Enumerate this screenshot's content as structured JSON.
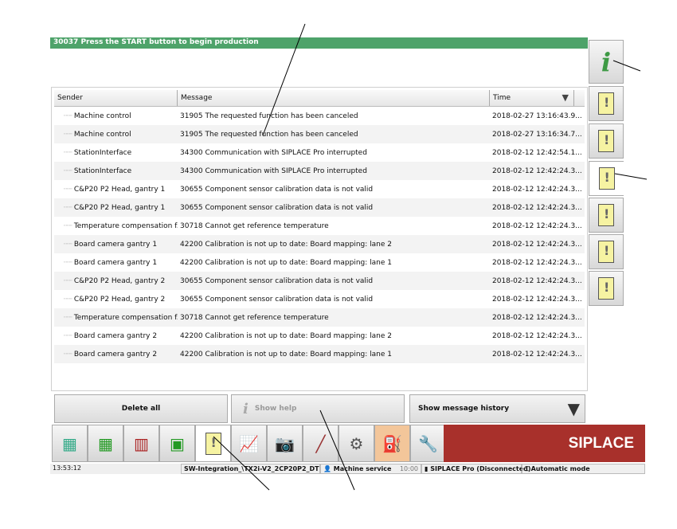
{
  "status_message": "30037 Press the START button to begin production",
  "table": {
    "columns": [
      "Sender",
      "Message",
      "Time"
    ],
    "rows": [
      [
        "Machine control",
        "31905 The requested function has been canceled",
        "2018-02-27 13:16:43.9..."
      ],
      [
        "Machine control",
        "31905 The requested function has been canceled",
        "2018-02-27 13:16:34.7..."
      ],
      [
        "StationInterface",
        "34300 Communication with SIPLACE Pro interrupted",
        "2018-02-12 12:42:54.1..."
      ],
      [
        "StationInterface",
        "34300 Communication with SIPLACE Pro interrupted",
        "2018-02-12 12:42:24.3..."
      ],
      [
        "C&P20 P2 Head, gantry 1",
        "30655 Component sensor calibration data is not valid",
        "2018-02-12 12:42:24.3..."
      ],
      [
        "C&P20 P2 Head, gantry 1",
        "30655 Component sensor calibration data is not valid",
        "2018-02-12 12:42:24.3..."
      ],
      [
        "Temperature compensation f...",
        "30718 Cannot get reference temperature",
        "2018-02-12 12:42:24.3..."
      ],
      [
        "Board camera gantry 1",
        "42200 Calibration is not up to date: Board mapping: lane 2",
        "2018-02-12 12:42:24.3..."
      ],
      [
        "Board camera gantry 1",
        "42200 Calibration is not up to date: Board mapping: lane 1",
        "2018-02-12 12:42:24.3..."
      ],
      [
        "C&P20 P2 Head, gantry 2",
        "30655 Component sensor calibration data is not valid",
        "2018-02-12 12:42:24.3..."
      ],
      [
        "C&P20 P2 Head, gantry 2",
        "30655 Component sensor calibration data is not valid",
        "2018-02-12 12:42:24.3..."
      ],
      [
        "Temperature compensation f...",
        "30718 Cannot get reference temperature",
        "2018-02-12 12:42:24.3..."
      ],
      [
        "Board camera gantry 2",
        "42200 Calibration is not up to date: Board mapping: lane 2",
        "2018-02-12 12:42:24.3..."
      ],
      [
        "Board camera gantry 2",
        "42200 Calibration is not up to date: Board mapping: lane 1",
        "2018-02-12 12:42:24.3..."
      ]
    ]
  },
  "buttons": {
    "delete_all": "Delete all",
    "show_help": "Show help",
    "show_history": "Show message history"
  },
  "brand": "SIPLACE",
  "statusbar": {
    "time": "13:53:12",
    "station": "SW-Integration_\\TX2i-V2_2CP20P2_DT",
    "user": "Machine service",
    "user_time": "10:00",
    "pro": "SIPLACE Pro (Disconnected)",
    "mode": "Automatic mode"
  },
  "colors": {
    "status_green": "#4ea36a",
    "brand_red": "#a8302b",
    "message_icon_yellow": "#f6f3a2",
    "active_tool_orange": "#f3c69a"
  }
}
